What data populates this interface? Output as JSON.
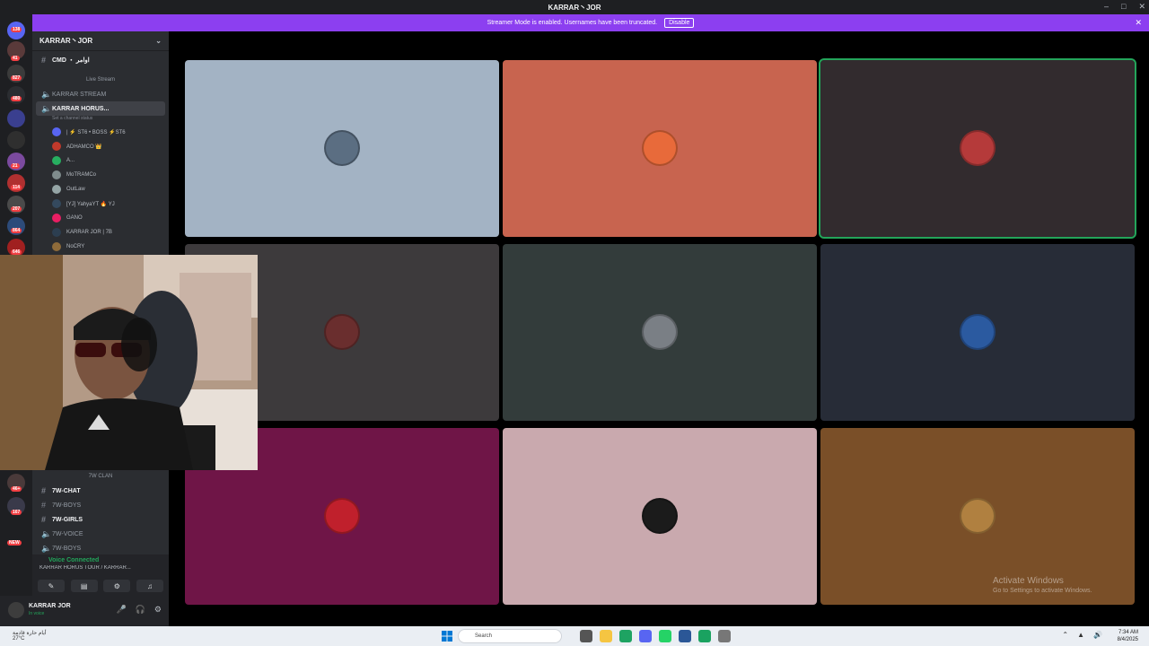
{
  "window": {
    "title": "KARRAR丶JOR"
  },
  "banner": {
    "text": "Streamer Mode is enabled. Usernames have been truncated.",
    "button": "Disable"
  },
  "guild_badges": [
    "138",
    "41",
    "827",
    "480",
    "21",
    "114",
    "207",
    "864",
    "646",
    "46+",
    "167",
    "NEW"
  ],
  "server": {
    "name": "KARRAR丶JOR"
  },
  "channels": {
    "top_text": "CMD ・ اوامر",
    "live_category": "Live Stream",
    "voice_1": "KARRAR STREAM",
    "voice_2": "KARRAR HORUS...",
    "voice_2_status": "Set a channel status"
  },
  "members": [
    {
      "name": "| ⚡ ST6 • BOSS ⚡ST6",
      "color": "#5865f2"
    },
    {
      "name": "ADHAMCO 👑",
      "color": "#c0392b"
    },
    {
      "name": "A...",
      "color": "#27ae60"
    },
    {
      "name": "MoTRAMCo",
      "color": "#7f8c8d"
    },
    {
      "name": "OutLaw",
      "color": "#95a5a6"
    },
    {
      "name": "[YJ] YahyaYT 🔥 YJ",
      "color": "#34495e"
    },
    {
      "name": "GANO",
      "color": "#e91e63"
    },
    {
      "name": "KARRAR JOR | 7B",
      "color": "#2c3e50"
    },
    {
      "name": "NoCRY",
      "color": "#8e6b3a"
    }
  ],
  "lower_channels": {
    "category": "7W CLAN",
    "items": [
      "7W-CHAT",
      "7W-BOYS",
      "7W-GIRLS",
      "7W-VOICE",
      "7W-BOYS"
    ]
  },
  "voice": {
    "status": "Voice Connected",
    "channel": "KARRAR HORUS TOUR / KARRAR..."
  },
  "user": {
    "name": "KARRAR JOR",
    "status": "In voice"
  },
  "tiles": [
    {
      "color": "#a3b3c4",
      "avatar": "#5b6e82"
    },
    {
      "color": "#c8644f",
      "avatar": "#e86a3a"
    },
    {
      "color": "#322b2e",
      "avatar": "#b53a3a"
    },
    {
      "color": "#3d3a3c",
      "avatar": "#6a2e2e"
    },
    {
      "color": "#333c3b",
      "avatar": "#7a7f85"
    },
    {
      "color": "#272c37",
      "avatar": "#2b5aa0"
    },
    {
      "color": "#6f1547",
      "avatar": "#c0202c"
    },
    {
      "color": "#c9a9ae",
      "avatar": "#1b1b1b"
    },
    {
      "color": "#7a4f28",
      "avatar": "#b08040"
    }
  ],
  "watermark": {
    "title": "Activate Windows",
    "sub": "Go to Settings to activate Windows."
  },
  "taskbar": {
    "weather_title": "أيام حارة قادمة",
    "weather_temp": "27°C",
    "search": "Search",
    "time": "7:34 AM",
    "date": "8/4/2025"
  }
}
